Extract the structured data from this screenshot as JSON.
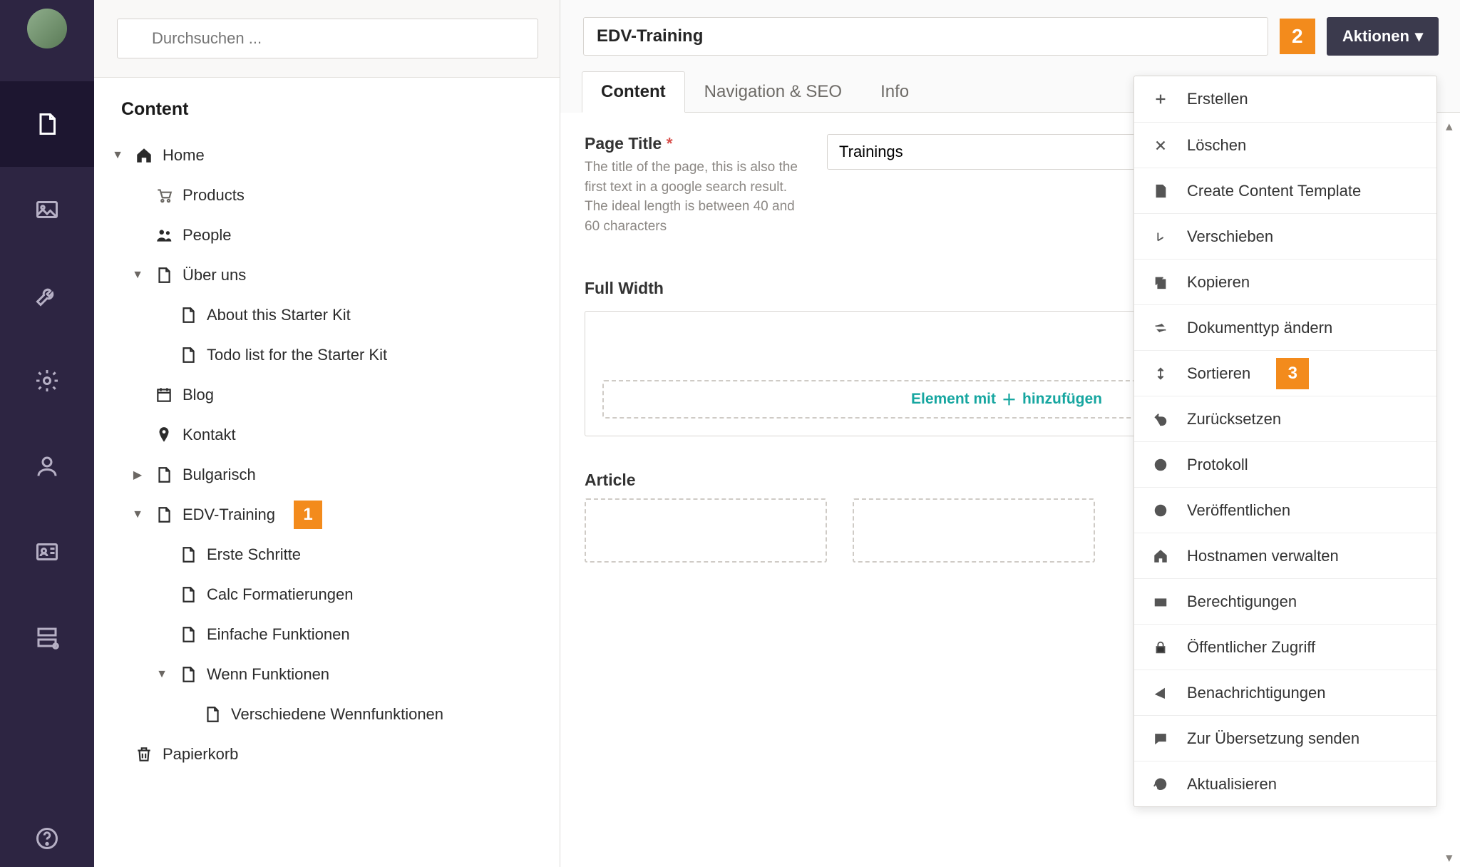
{
  "search": {
    "placeholder": "Durchsuchen ..."
  },
  "panel_title": "Content",
  "tree": {
    "home": "Home",
    "products": "Products",
    "people": "People",
    "uber": "Über uns",
    "about": "About this Starter Kit",
    "todo": "Todo list for the Starter Kit",
    "blog": "Blog",
    "kontakt": "Kontakt",
    "bulgarisch": "Bulgarisch",
    "edv": "EDV-Training",
    "erste": "Erste Schritte",
    "calc": "Calc Formatierungen",
    "einfache": "Einfache Funktionen",
    "wenn": "Wenn Funktionen",
    "versch": "Verschiedene Wennfunktionen",
    "trash": "Papierkorb"
  },
  "markers": {
    "one": "1",
    "two": "2",
    "three": "3"
  },
  "header": {
    "title_value": "EDV-Training",
    "actions": "Aktionen"
  },
  "tabs": {
    "content": "Content",
    "nav": "Navigation & SEO",
    "info": "Info"
  },
  "fields": {
    "page_title_label": "Page Title",
    "page_title_help": "The title of the page, this is also the first text in a google search result. The ideal length is between 40 and 60 characters",
    "page_title_value": "Trainings",
    "full_width": "Full Width",
    "add_element_a": "Element mit",
    "add_element_b": "hinzufügen",
    "article": "Article"
  },
  "actions_menu": [
    {
      "icon": "plus",
      "label": "Erstellen"
    },
    {
      "icon": "x",
      "label": "Löschen"
    },
    {
      "icon": "template",
      "label": "Create Content Template"
    },
    {
      "icon": "move",
      "label": "Verschieben"
    },
    {
      "icon": "copy",
      "label": "Kopieren"
    },
    {
      "icon": "swap",
      "label": "Dokumenttyp ändern"
    },
    {
      "icon": "sort",
      "label": "Sortieren",
      "marker": "3"
    },
    {
      "icon": "undo",
      "label": "Zurücksetzen"
    },
    {
      "icon": "clock",
      "label": "Protokoll"
    },
    {
      "icon": "globe",
      "label": "Veröffentlichen"
    },
    {
      "icon": "home",
      "label": "Hostnamen verwalten"
    },
    {
      "icon": "perm",
      "label": "Berechtigungen"
    },
    {
      "icon": "lock",
      "label": "Öffentlicher Zugriff"
    },
    {
      "icon": "bell",
      "label": "Benachrichtigungen"
    },
    {
      "icon": "chat",
      "label": "Zur Übersetzung senden"
    },
    {
      "icon": "refresh",
      "label": "Aktualisieren"
    }
  ]
}
